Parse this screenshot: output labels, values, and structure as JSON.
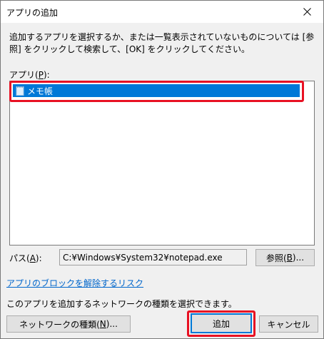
{
  "window": {
    "title": "アプリの追加"
  },
  "description": "追加するアプリを選択するか、または一覧表示されていないものについては [参照] をクリックして検索して、[OK] をクリックしてください。",
  "apps": {
    "label_prefix": "アプリ(",
    "label_key": "P",
    "label_suffix": "):",
    "items": [
      {
        "label": "メモ帳",
        "icon": "notepad-icon",
        "selected": true
      }
    ]
  },
  "path": {
    "label_prefix": "パス(",
    "label_key": "A",
    "label_suffix": "):",
    "value": "C:¥Windows¥System32¥notepad.exe"
  },
  "buttons": {
    "browse_prefix": "参照(",
    "browse_key": "B",
    "browse_suffix": ")...",
    "network_prefix": "ネットワークの種類(",
    "network_key": "N",
    "network_suffix": ")...",
    "add": "追加",
    "cancel": "キャンセル"
  },
  "risk_link": "アプリのブロックを解除するリスク",
  "info_text": "このアプリを追加するネットワークの種類を選択できます。",
  "colors": {
    "selection": "#0078d7",
    "highlight": "#e81123",
    "link": "#0066cc"
  }
}
